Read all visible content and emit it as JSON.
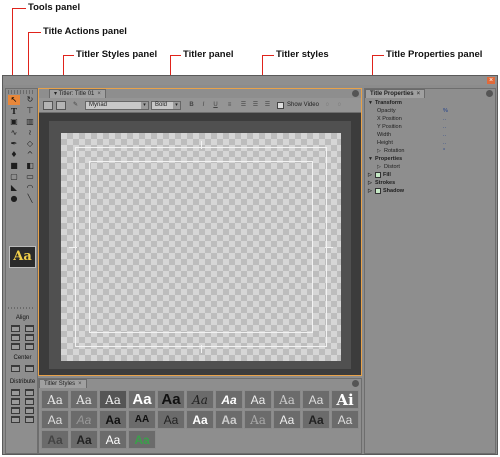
{
  "callouts": {
    "tools_panel": "Tools panel",
    "title_actions_panel": "Title Actions panel",
    "titler_styles_panel": "Titler Styles panel",
    "titler_panel": "Titler panel",
    "titler_styles": "Titler styles",
    "title_properties_panel": "Title Properties panel"
  },
  "titler": {
    "tab_label": "Titler: Title 01",
    "font_family": "Myriad",
    "font_style": "Bold",
    "show_video_label": "Show Video"
  },
  "tools": {
    "style_swatch": "Aa",
    "align_label": "Align",
    "center_label": "Center",
    "distribute_label": "Distribute"
  },
  "styles_panel": {
    "tab_label": "Titler Styles",
    "swatches": [
      "Aa",
      "Aa",
      "Aa",
      "Aa",
      "Aa",
      "Aa",
      "Aa",
      "Aa",
      "Aa",
      "Aa",
      "Ai",
      "Aa",
      "Aa",
      "Aa",
      "AA",
      "Aa",
      "Aa",
      "Aa",
      "Aa",
      "Aa",
      "Aa",
      "Aa",
      "Aa",
      "Aa",
      "Aa",
      "Aa"
    ]
  },
  "properties": {
    "tab_label": "Title Properties",
    "transform": "Transform",
    "opacity": "Opacity",
    "opacity_val": "%",
    "x_position": "X Position",
    "y_position": "Y Position",
    "width": "Width",
    "height": "Height",
    "rotation": "Rotation",
    "rotation_val": "°",
    "properties_section": "Properties",
    "distort": "Distort",
    "fill": "Fill",
    "strokes": "Strokes",
    "shadow": "Shadow"
  },
  "colors": {
    "callout_line": "#e0231b",
    "panel_highlight": "#e8a24a",
    "accent_yellow": "#f2d04a"
  }
}
